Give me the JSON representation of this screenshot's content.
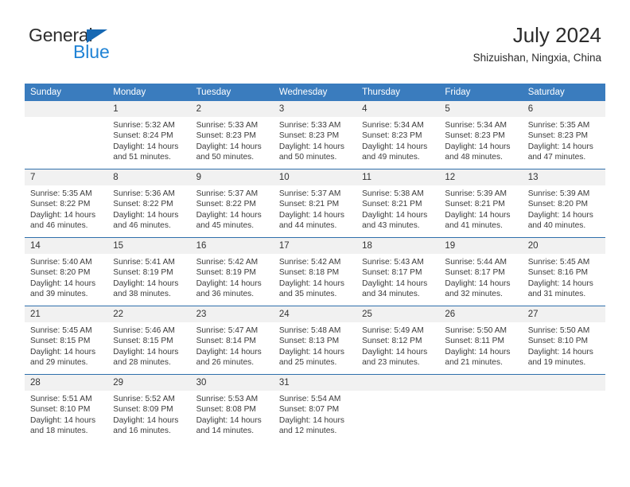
{
  "logo": {
    "primary_text": "General",
    "secondary_text": "Blue",
    "primary_color": "#2e2e2e",
    "secondary_color": "#2083d5",
    "triangle_color": "#1668b3"
  },
  "header": {
    "title": "July 2024",
    "subtitle": "Shizuishan, Ningxia, China"
  },
  "theme": {
    "header_row_bg": "#3a7cbe",
    "header_row_text": "#ffffff",
    "daynum_bg": "#f1f1f1",
    "row_separator": "#2f6fab",
    "body_text": "#3b3b3b"
  },
  "weekdays": [
    "Sunday",
    "Monday",
    "Tuesday",
    "Wednesday",
    "Thursday",
    "Friday",
    "Saturday"
  ],
  "labels": {
    "sunrise_prefix": "Sunrise:",
    "sunset_prefix": "Sunset:",
    "daylight_prefix": "Daylight:"
  },
  "weeks": [
    [
      {
        "day": ""
      },
      {
        "day": "1",
        "sunrise": "Sunrise: 5:32 AM",
        "sunset": "Sunset: 8:24 PM",
        "daylight_line1": "Daylight: 14 hours",
        "daylight_line2": "and 51 minutes."
      },
      {
        "day": "2",
        "sunrise": "Sunrise: 5:33 AM",
        "sunset": "Sunset: 8:23 PM",
        "daylight_line1": "Daylight: 14 hours",
        "daylight_line2": "and 50 minutes."
      },
      {
        "day": "3",
        "sunrise": "Sunrise: 5:33 AM",
        "sunset": "Sunset: 8:23 PM",
        "daylight_line1": "Daylight: 14 hours",
        "daylight_line2": "and 50 minutes."
      },
      {
        "day": "4",
        "sunrise": "Sunrise: 5:34 AM",
        "sunset": "Sunset: 8:23 PM",
        "daylight_line1": "Daylight: 14 hours",
        "daylight_line2": "and 49 minutes."
      },
      {
        "day": "5",
        "sunrise": "Sunrise: 5:34 AM",
        "sunset": "Sunset: 8:23 PM",
        "daylight_line1": "Daylight: 14 hours",
        "daylight_line2": "and 48 minutes."
      },
      {
        "day": "6",
        "sunrise": "Sunrise: 5:35 AM",
        "sunset": "Sunset: 8:23 PM",
        "daylight_line1": "Daylight: 14 hours",
        "daylight_line2": "and 47 minutes."
      }
    ],
    [
      {
        "day": "7",
        "sunrise": "Sunrise: 5:35 AM",
        "sunset": "Sunset: 8:22 PM",
        "daylight_line1": "Daylight: 14 hours",
        "daylight_line2": "and 46 minutes."
      },
      {
        "day": "8",
        "sunrise": "Sunrise: 5:36 AM",
        "sunset": "Sunset: 8:22 PM",
        "daylight_line1": "Daylight: 14 hours",
        "daylight_line2": "and 46 minutes."
      },
      {
        "day": "9",
        "sunrise": "Sunrise: 5:37 AM",
        "sunset": "Sunset: 8:22 PM",
        "daylight_line1": "Daylight: 14 hours",
        "daylight_line2": "and 45 minutes."
      },
      {
        "day": "10",
        "sunrise": "Sunrise: 5:37 AM",
        "sunset": "Sunset: 8:21 PM",
        "daylight_line1": "Daylight: 14 hours",
        "daylight_line2": "and 44 minutes."
      },
      {
        "day": "11",
        "sunrise": "Sunrise: 5:38 AM",
        "sunset": "Sunset: 8:21 PM",
        "daylight_line1": "Daylight: 14 hours",
        "daylight_line2": "and 43 minutes."
      },
      {
        "day": "12",
        "sunrise": "Sunrise: 5:39 AM",
        "sunset": "Sunset: 8:21 PM",
        "daylight_line1": "Daylight: 14 hours",
        "daylight_line2": "and 41 minutes."
      },
      {
        "day": "13",
        "sunrise": "Sunrise: 5:39 AM",
        "sunset": "Sunset: 8:20 PM",
        "daylight_line1": "Daylight: 14 hours",
        "daylight_line2": "and 40 minutes."
      }
    ],
    [
      {
        "day": "14",
        "sunrise": "Sunrise: 5:40 AM",
        "sunset": "Sunset: 8:20 PM",
        "daylight_line1": "Daylight: 14 hours",
        "daylight_line2": "and 39 minutes."
      },
      {
        "day": "15",
        "sunrise": "Sunrise: 5:41 AM",
        "sunset": "Sunset: 8:19 PM",
        "daylight_line1": "Daylight: 14 hours",
        "daylight_line2": "and 38 minutes."
      },
      {
        "day": "16",
        "sunrise": "Sunrise: 5:42 AM",
        "sunset": "Sunset: 8:19 PM",
        "daylight_line1": "Daylight: 14 hours",
        "daylight_line2": "and 36 minutes."
      },
      {
        "day": "17",
        "sunrise": "Sunrise: 5:42 AM",
        "sunset": "Sunset: 8:18 PM",
        "daylight_line1": "Daylight: 14 hours",
        "daylight_line2": "and 35 minutes."
      },
      {
        "day": "18",
        "sunrise": "Sunrise: 5:43 AM",
        "sunset": "Sunset: 8:17 PM",
        "daylight_line1": "Daylight: 14 hours",
        "daylight_line2": "and 34 minutes."
      },
      {
        "day": "19",
        "sunrise": "Sunrise: 5:44 AM",
        "sunset": "Sunset: 8:17 PM",
        "daylight_line1": "Daylight: 14 hours",
        "daylight_line2": "and 32 minutes."
      },
      {
        "day": "20",
        "sunrise": "Sunrise: 5:45 AM",
        "sunset": "Sunset: 8:16 PM",
        "daylight_line1": "Daylight: 14 hours",
        "daylight_line2": "and 31 minutes."
      }
    ],
    [
      {
        "day": "21",
        "sunrise": "Sunrise: 5:45 AM",
        "sunset": "Sunset: 8:15 PM",
        "daylight_line1": "Daylight: 14 hours",
        "daylight_line2": "and 29 minutes."
      },
      {
        "day": "22",
        "sunrise": "Sunrise: 5:46 AM",
        "sunset": "Sunset: 8:15 PM",
        "daylight_line1": "Daylight: 14 hours",
        "daylight_line2": "and 28 minutes."
      },
      {
        "day": "23",
        "sunrise": "Sunrise: 5:47 AM",
        "sunset": "Sunset: 8:14 PM",
        "daylight_line1": "Daylight: 14 hours",
        "daylight_line2": "and 26 minutes."
      },
      {
        "day": "24",
        "sunrise": "Sunrise: 5:48 AM",
        "sunset": "Sunset: 8:13 PM",
        "daylight_line1": "Daylight: 14 hours",
        "daylight_line2": "and 25 minutes."
      },
      {
        "day": "25",
        "sunrise": "Sunrise: 5:49 AM",
        "sunset": "Sunset: 8:12 PM",
        "daylight_line1": "Daylight: 14 hours",
        "daylight_line2": "and 23 minutes."
      },
      {
        "day": "26",
        "sunrise": "Sunrise: 5:50 AM",
        "sunset": "Sunset: 8:11 PM",
        "daylight_line1": "Daylight: 14 hours",
        "daylight_line2": "and 21 minutes."
      },
      {
        "day": "27",
        "sunrise": "Sunrise: 5:50 AM",
        "sunset": "Sunset: 8:10 PM",
        "daylight_line1": "Daylight: 14 hours",
        "daylight_line2": "and 19 minutes."
      }
    ],
    [
      {
        "day": "28",
        "sunrise": "Sunrise: 5:51 AM",
        "sunset": "Sunset: 8:10 PM",
        "daylight_line1": "Daylight: 14 hours",
        "daylight_line2": "and 18 minutes."
      },
      {
        "day": "29",
        "sunrise": "Sunrise: 5:52 AM",
        "sunset": "Sunset: 8:09 PM",
        "daylight_line1": "Daylight: 14 hours",
        "daylight_line2": "and 16 minutes."
      },
      {
        "day": "30",
        "sunrise": "Sunrise: 5:53 AM",
        "sunset": "Sunset: 8:08 PM",
        "daylight_line1": "Daylight: 14 hours",
        "daylight_line2": "and 14 minutes."
      },
      {
        "day": "31",
        "sunrise": "Sunrise: 5:54 AM",
        "sunset": "Sunset: 8:07 PM",
        "daylight_line1": "Daylight: 14 hours",
        "daylight_line2": "and 12 minutes."
      },
      {
        "day": ""
      },
      {
        "day": ""
      },
      {
        "day": ""
      }
    ]
  ]
}
